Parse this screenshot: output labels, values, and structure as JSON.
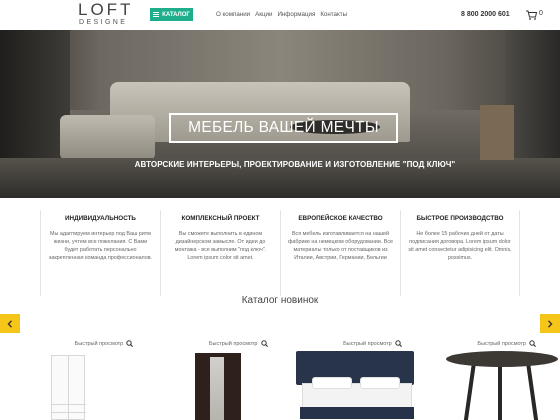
{
  "header": {
    "logo_top": "LOFT",
    "logo_bottom": "DESIGNE",
    "catalog_label": "КАТАЛОГ",
    "nav": [
      "О компании",
      "Акции",
      "Информация",
      "Контакты"
    ],
    "phone": "8 800 2000 601",
    "cart_count": "0",
    "accent_color": "#1fae8c"
  },
  "hero": {
    "title": "МЕБЕЛЬ ВАШЕЙ МЕЧТЫ",
    "subtitle": "АВТОРСКИЕ ИНТЕРЬЕРЫ, ПРОЕКТИРОВАНИЕ И ИЗГОТОВЛЕНИЕ \"ПОД КЛЮЧ\""
  },
  "features": [
    {
      "title": "ИНДИВИДУАЛЬНОСТЬ",
      "text": "Мы адаптируем интерьер под Ваш ритм жизни, учтем все пожелания. С Вами будет работать персонально закрепленная команда профессионалов."
    },
    {
      "title": "КОМПЛЕКСНЫЙ ПРОЕКТ",
      "text": "Вы сможете выполнить в едином дизайнерском замысле. От идеи до монтажа - все выполним \"под ключ\". Lorem ipsum color sit amet."
    },
    {
      "title": "ЕВРОПЕЙСКОЕ КАЧЕСТВО",
      "text": "Вся мебель изготавливается на нашей фабрике на немецком оборудовании. Все материалы только от поставщиков из Италии, Австрии, Германии, Бельгии"
    },
    {
      "title": "БЫСТРОЕ ПРОИЗВОДСТВО",
      "text": "Не более 15 рабочих дней от даты подписания договора. Lorem ipsum dolor sit amet consectetur adipisicing elit. Omnis, possimus."
    }
  ],
  "catalog": {
    "title": "Каталог новинок",
    "quick_view_label": "Быстрый просмотр",
    "arrow_color": "#f5c518"
  }
}
